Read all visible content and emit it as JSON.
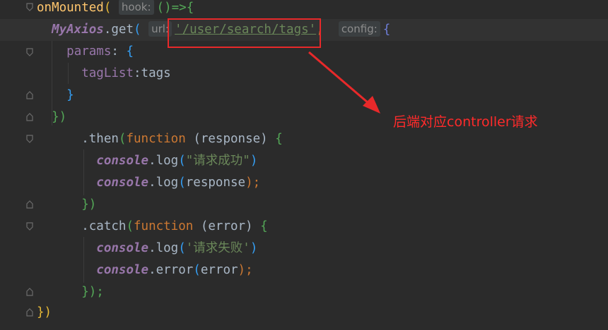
{
  "editor": {
    "hints": {
      "hook": "hook:",
      "url": "url:",
      "config": "config:"
    },
    "lines": {
      "l1": {
        "name": "onMounted",
        "open": "(",
        "arrow": "()=>",
        "brace": "{"
      },
      "l2": {
        "obj": "MyAxios",
        "dot": ".",
        "method": "get",
        "open": "(",
        "str": "'/user/search/tags'",
        "comma": ",",
        "brace": "{"
      },
      "l3": {
        "key": "params",
        "colon": ":",
        "brace": "{"
      },
      "l4": {
        "key": "tagList",
        "colon": ":",
        "val": "tags"
      },
      "l5": {
        "brace": "}"
      },
      "l6": {
        "close": "})"
      },
      "l7": {
        "dot": ".",
        "method": "then",
        "open": "(",
        "kw": "function",
        "params": "(response)",
        "brace": "{"
      },
      "l8": {
        "obj": "console",
        "dot": ".",
        "method": "log",
        "open": "(",
        "str": "\"请求成功\"",
        "close": ")"
      },
      "l9": {
        "obj": "console",
        "dot": ".",
        "method": "log",
        "open": "(",
        "arg": "response",
        "close": ");"
      },
      "l10": {
        "close": "})"
      },
      "l11": {
        "dot": ".",
        "method": "catch",
        "open": "(",
        "kw": "function",
        "params": "(error)",
        "brace": "{"
      },
      "l12": {
        "obj": "console",
        "dot": ".",
        "method": "log",
        "open": "(",
        "str": "'请求失败'",
        "close": ")"
      },
      "l13": {
        "obj": "console",
        "dot": ".",
        "method": "error",
        "open": "(",
        "arg": "error",
        "close": ");"
      },
      "l14": {
        "close": "});"
      },
      "l15": {
        "close": "})"
      }
    }
  },
  "annotation": {
    "text": "后端对应controller请求",
    "color": "#ff2b2b"
  },
  "colors": {
    "background": "#2b2b2b",
    "highlight_box": "#e8292a"
  }
}
